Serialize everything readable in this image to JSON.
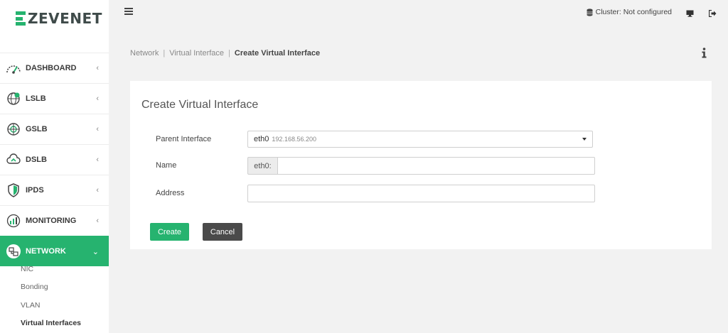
{
  "brand": {
    "name": "ZEVENET",
    "accent": "#26b36f"
  },
  "topbar": {
    "cluster_label": "Cluster: Not configured"
  },
  "sidebar": {
    "items": [
      {
        "label": "DASHBOARD",
        "icon": "dashboard-gauge-icon"
      },
      {
        "label": "LSLB",
        "icon": "globe-check-icon"
      },
      {
        "label": "GSLB",
        "icon": "globe-grid-icon"
      },
      {
        "label": "DSLB",
        "icon": "cloud-sync-icon"
      },
      {
        "label": "IPDS",
        "icon": "shield-icon"
      },
      {
        "label": "MONITORING",
        "icon": "monitoring-chart-icon"
      },
      {
        "label": "NETWORK",
        "icon": "network-icon"
      }
    ],
    "submenu": [
      "NIC",
      "Bonding",
      "VLAN",
      "Virtual Interfaces"
    ]
  },
  "breadcrumb": {
    "parts": [
      "Network",
      "Virtual Interface"
    ],
    "current": "Create Virtual Interface"
  },
  "form": {
    "title": "Create Virtual Interface",
    "parent_label": "Parent Interface",
    "parent_value": "eth0",
    "parent_ip": "192.168.56.200",
    "name_label": "Name",
    "name_prefix": "eth0:",
    "name_value": "",
    "address_label": "Address",
    "address_value": "",
    "create_label": "Create",
    "cancel_label": "Cancel"
  }
}
